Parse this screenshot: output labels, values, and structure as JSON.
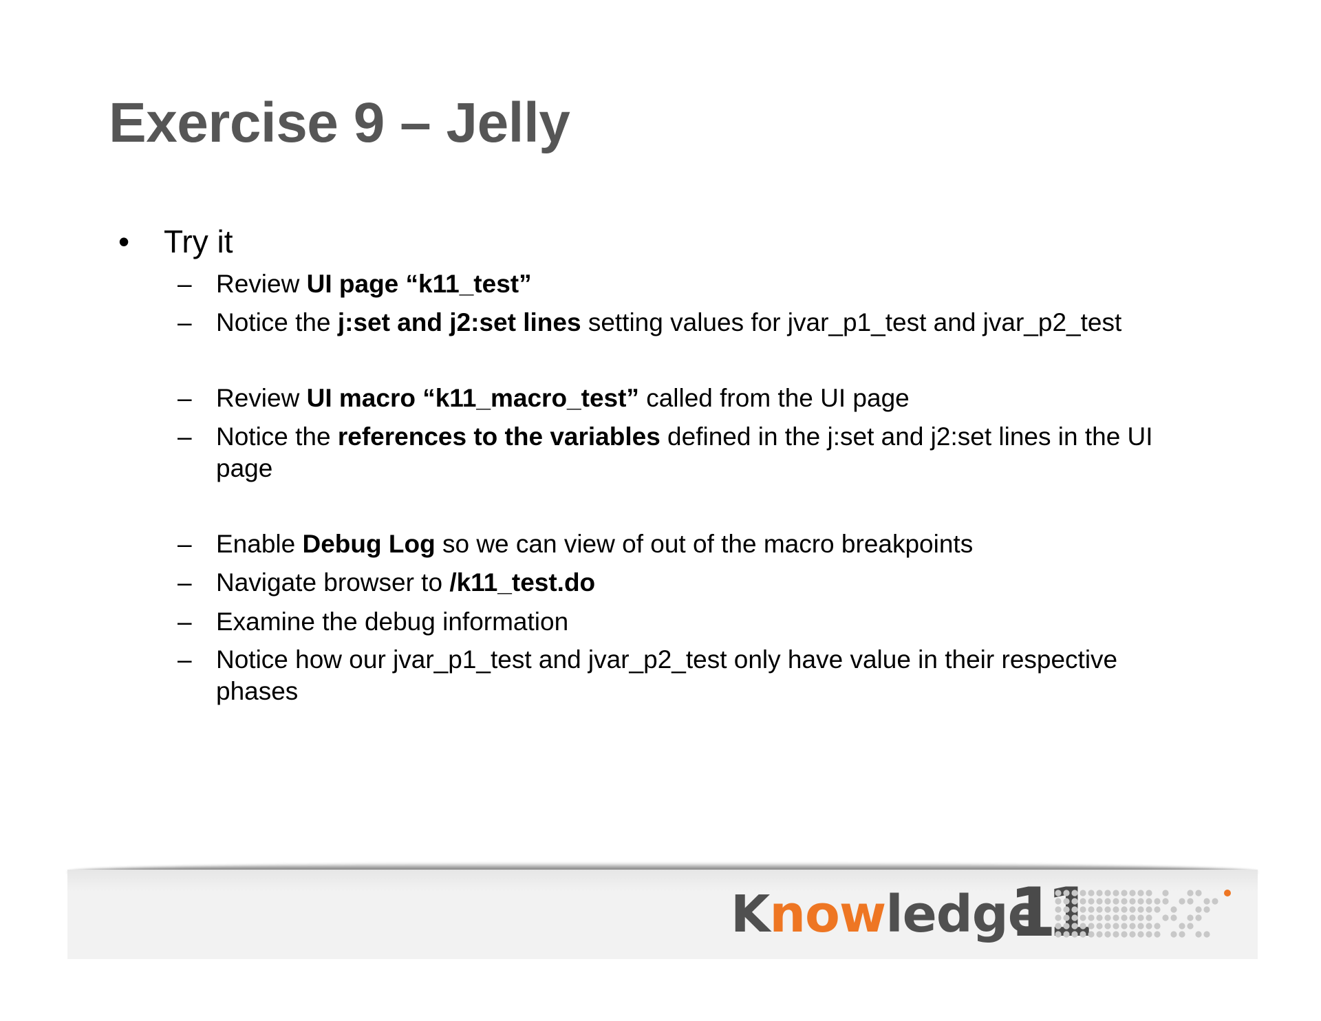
{
  "slide": {
    "title": "Exercise 9 – Jelly",
    "bullet_marker": "•",
    "bullet_text": "Try it",
    "dash": "–",
    "items": [
      {
        "parts": [
          {
            "t": "Review "
          },
          {
            "t": "UI page “k11_test”",
            "b": true
          }
        ]
      },
      {
        "parts": [
          {
            "t": "Notice the "
          },
          {
            "t": "j:set and j2:set lines",
            "b": true
          },
          {
            "t": " setting values for jvar_p1_test and jvar_p2_test"
          }
        ]
      },
      {
        "parts": [
          {
            "t": "Review "
          },
          {
            "t": "UI macro “k11_macro_test”",
            "b": true
          },
          {
            "t": " called from the UI page"
          }
        ]
      },
      {
        "parts": [
          {
            "t": "Notice the "
          },
          {
            "t": "references to the variables",
            "b": true
          },
          {
            "t": " defined in the j:set and j2:set lines in the UI page"
          }
        ]
      },
      {
        "parts": [
          {
            "t": "Enable "
          },
          {
            "t": "Debug Log",
            "b": true
          },
          {
            "t": " so we can view of out of the macro breakpoints"
          }
        ]
      },
      {
        "parts": [
          {
            "t": "Navigate browser to "
          },
          {
            "t": "/k11_test.do",
            "b": true
          }
        ]
      },
      {
        "parts": [
          {
            "t": "Examine the debug information"
          }
        ]
      },
      {
        "parts": [
          {
            "t": "Notice how our jvar_p1_test and jvar_p2_test only have value in their respective phases"
          }
        ]
      }
    ]
  },
  "logo": {
    "k": "K",
    "now": "now",
    "ledge": "ledge",
    "number": "11",
    "dot_color": "#c8c8c8",
    "accent_color": "#ee7623"
  }
}
